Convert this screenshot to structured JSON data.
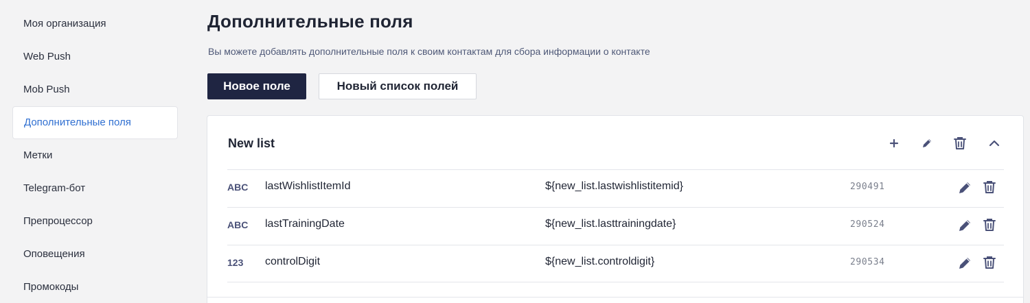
{
  "sidebar": {
    "items": [
      {
        "label": "Моя организация",
        "active": false
      },
      {
        "label": "Web Push",
        "active": false
      },
      {
        "label": "Mob Push",
        "active": false
      },
      {
        "label": "Дополнительные поля",
        "active": true
      },
      {
        "label": "Метки",
        "active": false
      },
      {
        "label": "Telegram-бот",
        "active": false
      },
      {
        "label": "Препроцессор",
        "active": false
      },
      {
        "label": "Оповещения",
        "active": false
      },
      {
        "label": "Промокоды",
        "active": false
      }
    ]
  },
  "main": {
    "title": "Дополнительные поля",
    "description": "Вы можете добавлять дополнительные поля к своим контактам для сбора информации о контакте",
    "new_field_label": "Новое поле",
    "new_list_label": "Новый список полей"
  },
  "card": {
    "title": "New list",
    "actions": [
      "plus-icon",
      "pencil-icon",
      "trash-icon",
      "chevron-up-icon"
    ],
    "fields": [
      {
        "type": "ABC",
        "name": "lastWishlistItemId",
        "variable": "${new_list.lastwishlistitemid}",
        "id": "290491"
      },
      {
        "type": "ABC",
        "name": "lastTrainingDate",
        "variable": "${new_list.lasttrainingdate}",
        "id": "290524"
      },
      {
        "type": "123",
        "name": "controlDigit",
        "variable": "${new_list.controldigit}",
        "id": "290534"
      }
    ]
  },
  "colors": {
    "accent": "#2f6fd1",
    "primary_button": "#1f2542",
    "icon": "#4a5178",
    "background": "#f3f3f4"
  }
}
